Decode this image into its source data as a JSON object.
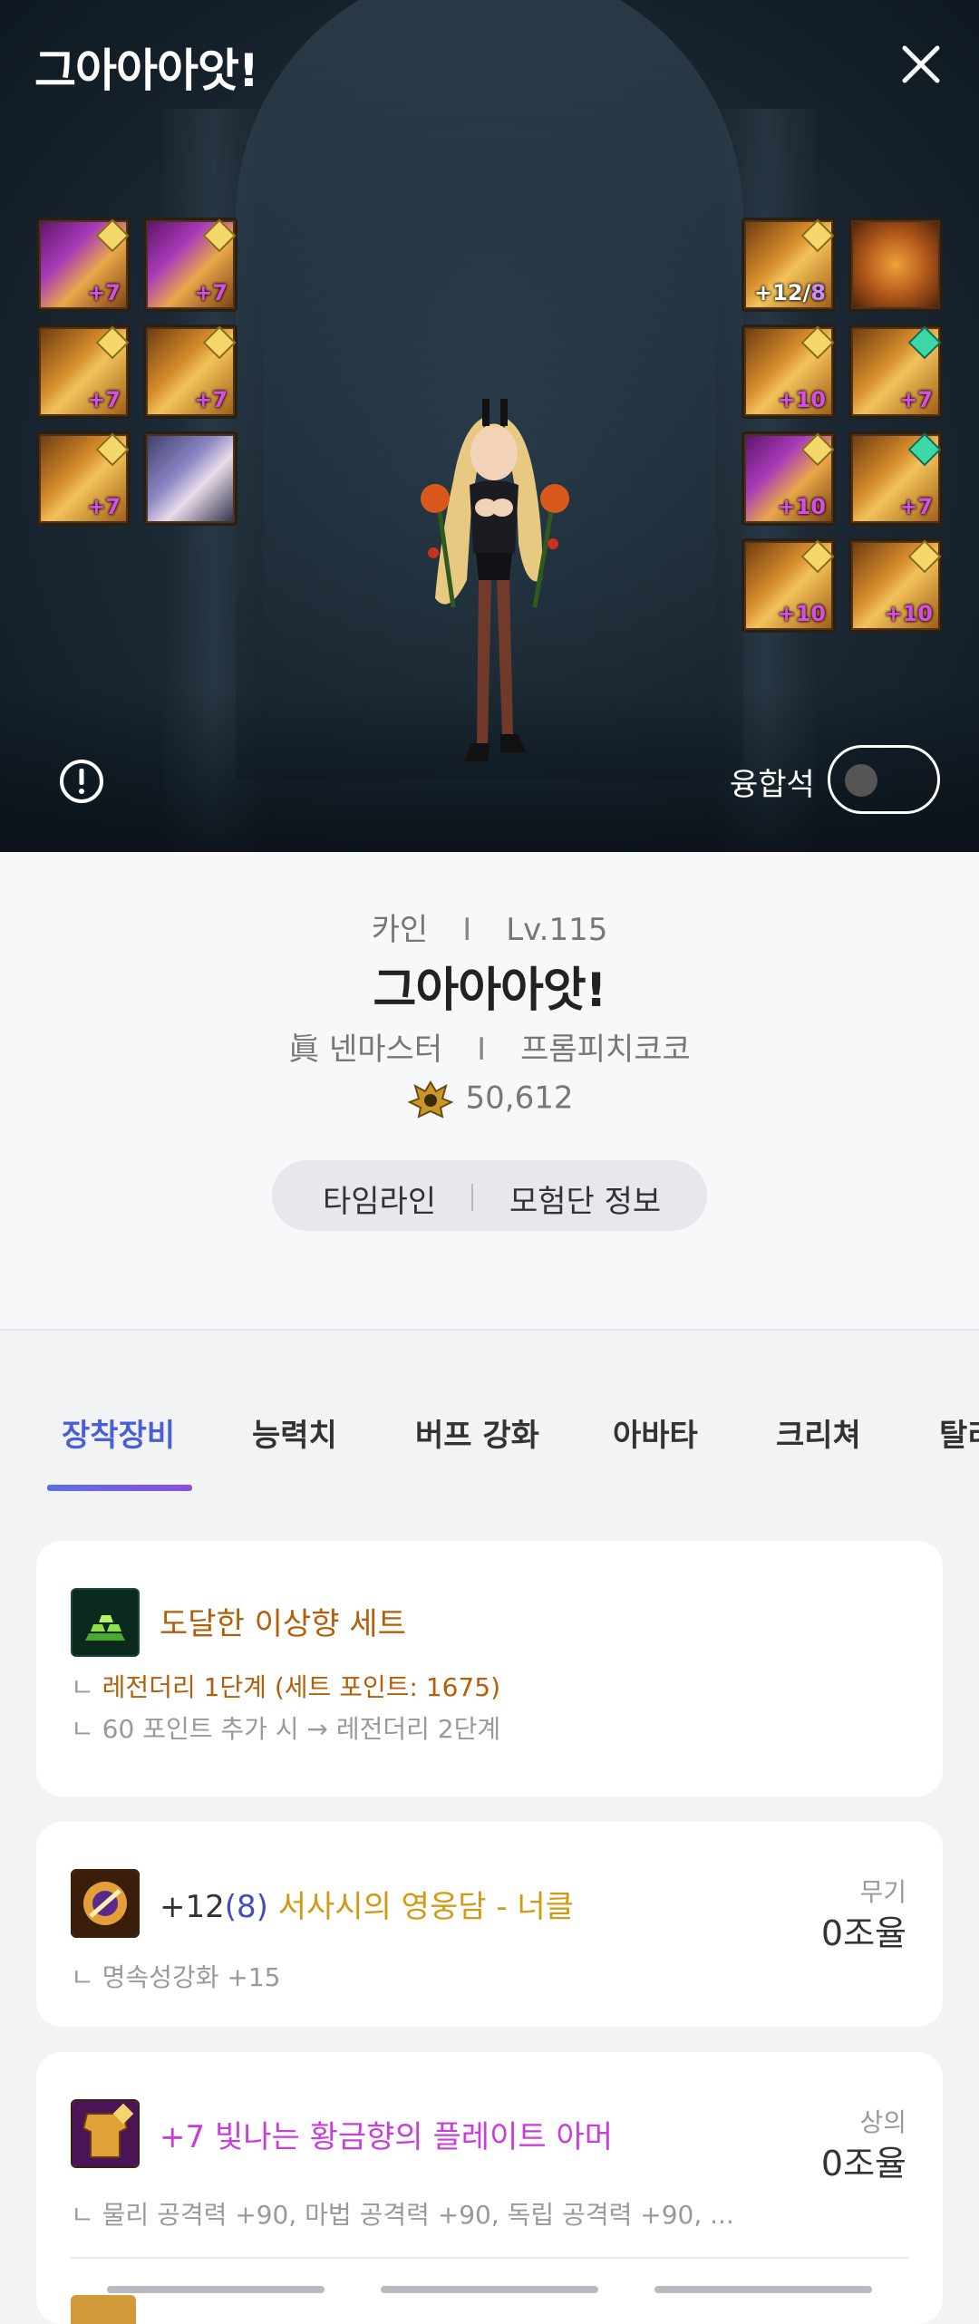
{
  "hero": {
    "title": "그아아아앗!",
    "fusion_label": "융합석",
    "fusion_toggle_on": false,
    "left_slots": [
      {
        "icon": "ring-icon",
        "level": "+7",
        "style": "purple"
      },
      {
        "icon": "armor-icon",
        "level": "+7",
        "style": "purple"
      },
      {
        "icon": "shoulder-icon",
        "level": "+7",
        "style": "gold"
      },
      {
        "icon": "pants-icon",
        "level": "+7",
        "style": "gold"
      },
      {
        "icon": "shoes-icon",
        "level": "+7",
        "style": "gold"
      },
      {
        "icon": "avatar-icon",
        "level": "",
        "style": "avatar"
      }
    ],
    "right_slots": [
      {
        "icon": "knuckle-icon",
        "level_main": "+12/",
        "level_amp": "8",
        "style": "gold"
      },
      {
        "icon": "title-icon",
        "level": "",
        "style": "ring"
      },
      {
        "icon": "wrist-icon",
        "level": "+10",
        "style": "gold"
      },
      {
        "icon": "necklace-icon",
        "level": "+7",
        "style": "gold"
      },
      {
        "icon": "bracelet-icon",
        "level": "+10",
        "style": "purple"
      },
      {
        "icon": "ring2-icon",
        "level": "+7",
        "style": "gold"
      },
      {
        "icon": "support-icon",
        "level": "+10",
        "style": "gold"
      },
      {
        "icon": "earring-icon",
        "level": "+10",
        "style": "gold"
      }
    ]
  },
  "profile": {
    "server": "카인",
    "level": "Lv.115",
    "name": "그아아아앗!",
    "job": "眞 넨마스터",
    "guild": "프롬피치코코",
    "fame": "50,612",
    "buttons": {
      "timeline": "타임라인",
      "adventure": "모험단 정보"
    }
  },
  "tabs": [
    "장착장비",
    "능력치",
    "버프 강화",
    "아바타",
    "크리쳐",
    "탈리"
  ],
  "set_card": {
    "title": "도달한 이상향 세트",
    "line1_prefix": "ㄴ ",
    "line1": "레전더리 1단계 (세트 포인트: 1675)",
    "line2": "ㄴ 60 포인트 추가 시 → 레전더리 2단계"
  },
  "items": [
    {
      "enchant": "+12",
      "amp": "(8)",
      "name": "서사시의 영웅담 - 너클",
      "slot": "무기",
      "value": "0조율",
      "sub": "ㄴ 명속성강화 +15"
    },
    {
      "enchant": "+7",
      "name": "빛나는 황금향의 플레이트 아머",
      "slot": "상의",
      "value": "0조율",
      "sub": "ㄴ 물리 공격력 +90, 마법 공격력 +90, 독립 공격력 +90, ..."
    }
  ],
  "colors": {
    "accent": "#4a5fd6",
    "epic_gold": "#d19a12",
    "legendary_orange": "#b35f0a",
    "amplified_blue": "#3f4ec4",
    "unique_magenta": "#c93ed8"
  }
}
